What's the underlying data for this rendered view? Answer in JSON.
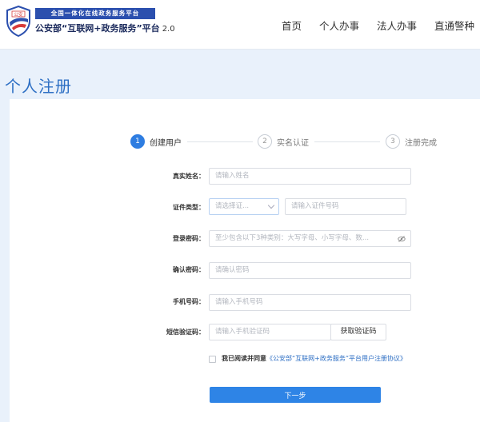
{
  "header": {
    "banner": "全国一体化在线政务服务平台",
    "shield_text": "公安",
    "title": "公安部“互联网+政务服务”平台",
    "version": "2.0",
    "nav": [
      "首页",
      "个人办事",
      "法人办事",
      "直通警种",
      "直"
    ]
  },
  "page_title": "个人注册",
  "steps": [
    {
      "num": "1",
      "label": "创建用户"
    },
    {
      "num": "2",
      "label": "实名认证"
    },
    {
      "num": "3",
      "label": "注册完成"
    }
  ],
  "form": {
    "name": {
      "label": "真实姓名：",
      "placeholder": "请输入姓名"
    },
    "id_type": {
      "label": "证件类型：",
      "placeholder": "请选择证...",
      "number_placeholder": "请输入证件号码"
    },
    "password": {
      "label": "登录密码：",
      "placeholder": "至少包含以下3种类别：大写字母、小写字母、数..."
    },
    "confirm": {
      "label": "确认密码：",
      "placeholder": "请确认密码"
    },
    "phone": {
      "label": "手机号码：",
      "placeholder": "请输入手机号码"
    },
    "sms": {
      "label": "短信验证码：",
      "placeholder": "请输入手机验证码",
      "button": "获取验证码"
    }
  },
  "agreement": {
    "prefix": "我已阅读并同意",
    "link": "《公安部“互联网+政务服务”平台用户注册协议》"
  },
  "next_button": "下一步"
}
